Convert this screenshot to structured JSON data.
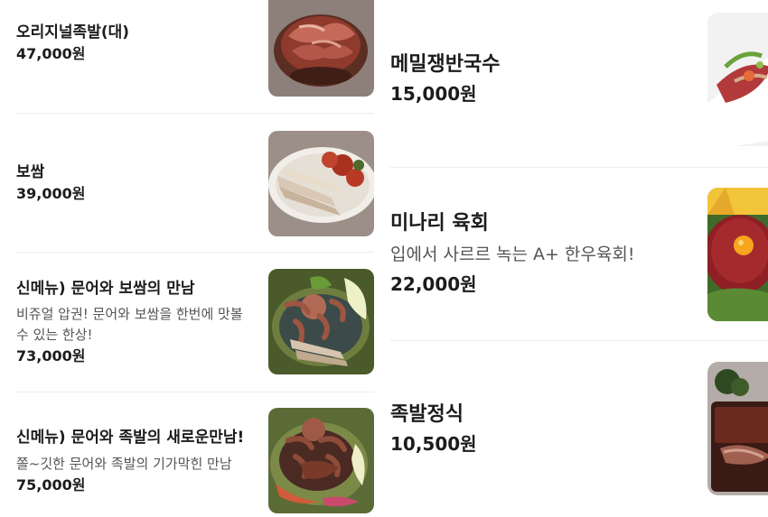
{
  "menu_left": [
    {
      "name": "오리지널족발(대)",
      "desc": "",
      "price": "47,000원",
      "image": "jokbal-platter"
    },
    {
      "name": "보쌈",
      "desc": "",
      "price": "39,000원",
      "image": "bossam-plate"
    },
    {
      "name": "신메뉴) 문어와 보쌈의 만남",
      "desc": "비쥬얼 압권! 문어와 보쌈을 한번에 맛볼 수 있는 한상!",
      "price": "73,000원",
      "image": "octopus-bossam"
    },
    {
      "name": "신메뉴) 문어와 족발의 새로운만남!",
      "desc": "쫄~깃한 문어와 족발의 기가막힌 만남",
      "price": "75,000원",
      "image": "octopus-jokbal"
    }
  ],
  "menu_right": [
    {
      "name": "메밀쟁반국수",
      "desc": "",
      "price": "15,000원",
      "image": "buckwheat-noodle-tray"
    },
    {
      "name": "미나리 육회",
      "desc": "입에서 사르르 녹는 A+ 한우육회!",
      "price": "22,000원",
      "image": "minari-yukhoe"
    },
    {
      "name": "족발정식",
      "desc": "",
      "price": "10,500원",
      "image": "jokbal-set-meal"
    }
  ],
  "colors": {
    "text": "#1c1c1c",
    "desc": "#555555",
    "divider": "#ececec",
    "background": "#ffffff"
  }
}
